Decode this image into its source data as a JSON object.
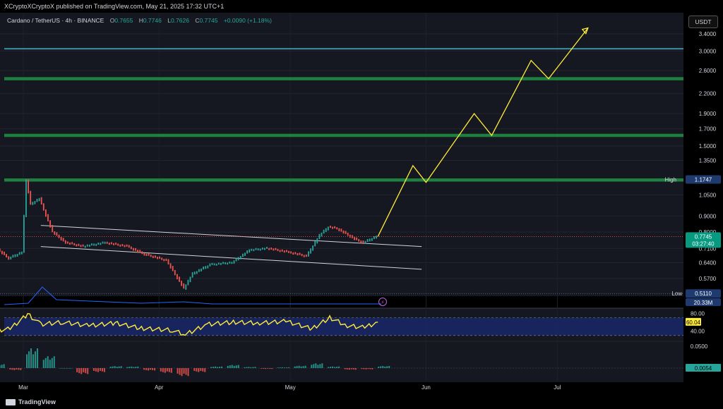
{
  "header": {
    "published": "XCryptoXCryptoX published on TradingView.com, May 21, 2025 17:32 UTC+1"
  },
  "symbol": {
    "name": "Cardano / TetherUS · 4h · BINANCE",
    "open_label": "O",
    "open": "0.7655",
    "high_label": "H",
    "high": "0.7746",
    "low_label": "L",
    "low": "0.7626",
    "close_label": "C",
    "close": "0.7745",
    "change": "+0.0090 (+1.18%)"
  },
  "currency_button": "USDT",
  "colors": {
    "background": "#161821",
    "level_green": "#1f7f3f",
    "level_blue": "#3a8fa6",
    "projection": "#ffeb3b",
    "rsi": "#ffeb3b",
    "rsi_band": "#1a2a78",
    "up": "#26a69a",
    "down": "#ef5350"
  },
  "chart_data": {
    "type": "line",
    "title": "Cardano / TetherUS",
    "y_scale": "log",
    "price_ticks": [
      "3.4000",
      "3.0000",
      "2.6000",
      "2.2000",
      "1.9000",
      "1.7000",
      "1.5000",
      "1.3500",
      "1.0500",
      "0.9000",
      "0.8000",
      "0.7100",
      "0.6400",
      "0.5700"
    ],
    "x_ticks": [
      "Mar",
      "Apr",
      "May",
      "Jun",
      "Jul"
    ],
    "price_history": {
      "x": [
        "2025-02-22",
        "2025-02-26",
        "2025-03-01",
        "2025-03-02",
        "2025-03-03",
        "2025-03-05",
        "2025-03-08",
        "2025-03-11",
        "2025-03-15",
        "2025-03-20",
        "2025-03-25",
        "2025-03-29",
        "2025-04-03",
        "2025-04-07",
        "2025-04-09",
        "2025-04-13",
        "2025-04-18",
        "2025-04-22",
        "2025-04-26",
        "2025-05-01",
        "2025-05-05",
        "2025-05-08",
        "2025-05-10",
        "2025-05-12",
        "2025-05-14",
        "2025-05-16",
        "2025-05-18",
        "2025-05-21"
      ],
      "y": [
        0.73,
        0.66,
        0.69,
        1.17,
        0.98,
        1.02,
        0.8,
        0.74,
        0.72,
        0.74,
        0.72,
        0.68,
        0.65,
        0.53,
        0.59,
        0.63,
        0.64,
        0.7,
        0.71,
        0.69,
        0.67,
        0.78,
        0.83,
        0.82,
        0.79,
        0.76,
        0.74,
        0.7745
      ]
    },
    "projection": {
      "x": [
        "2025-05-21",
        "2025-05-29",
        "2025-06-01",
        "2025-06-12",
        "2025-06-16",
        "2025-06-25",
        "2025-06-29",
        "2025-07-08"
      ],
      "y": [
        0.7745,
        1.3,
        1.15,
        1.9,
        1.62,
        2.8,
        2.45,
        3.55
      ]
    },
    "levels": [
      {
        "value": 3.05,
        "color": "#3a8fa6"
      },
      {
        "value": 2.45,
        "color": "#1f7f3f"
      },
      {
        "value": 1.62,
        "color": "#1f7f3f"
      },
      {
        "value": 1.17,
        "color": "#1f7f3f"
      }
    ],
    "channel": {
      "upper": {
        "x": [
          "2025-03-05",
          "2025-05-31"
        ],
        "y": [
          0.84,
          0.72
        ]
      },
      "lower": {
        "x": [
          "2025-03-05",
          "2025-05-31"
        ],
        "y": [
          0.72,
          0.61
        ]
      }
    },
    "badges": {
      "high_label": "High",
      "high_value": "1.1747",
      "last_price": "0.7745",
      "countdown": "03:27:40",
      "low_label": "Low",
      "low_value": "0.5110",
      "volume": "20.33M"
    },
    "rsi": {
      "ticks": [
        "80.00",
        "40.00"
      ],
      "value": "60.04",
      "band": [
        30,
        70
      ],
      "x": [
        "2025-02-22",
        "2025-02-26",
        "2025-03-02",
        "2025-03-05",
        "2025-03-10",
        "2025-03-16",
        "2025-03-22",
        "2025-03-28",
        "2025-04-04",
        "2025-04-07",
        "2025-04-12",
        "2025-04-18",
        "2025-04-24",
        "2025-04-30",
        "2025-05-06",
        "2025-05-10",
        "2025-05-14",
        "2025-05-18",
        "2025-05-21"
      ],
      "y": [
        40,
        45,
        78,
        55,
        60,
        52,
        58,
        46,
        42,
        32,
        55,
        60,
        58,
        62,
        45,
        70,
        52,
        48,
        60
      ]
    },
    "macd": {
      "ticks": [
        "0.0500"
      ],
      "value": "0.0054",
      "histogram": [
        0.01,
        -0.005,
        0.05,
        0.03,
        0.0,
        -0.015,
        -0.01,
        0.005,
        0.004,
        -0.006,
        -0.012,
        -0.02,
        -0.01,
        0.004,
        0.008,
        0.003,
        -0.002,
        0.002,
        0.006,
        0.012,
        0.004,
        -0.004,
        -0.003,
        0.0054
      ]
    }
  },
  "footer": {
    "brand": "TradingView"
  }
}
